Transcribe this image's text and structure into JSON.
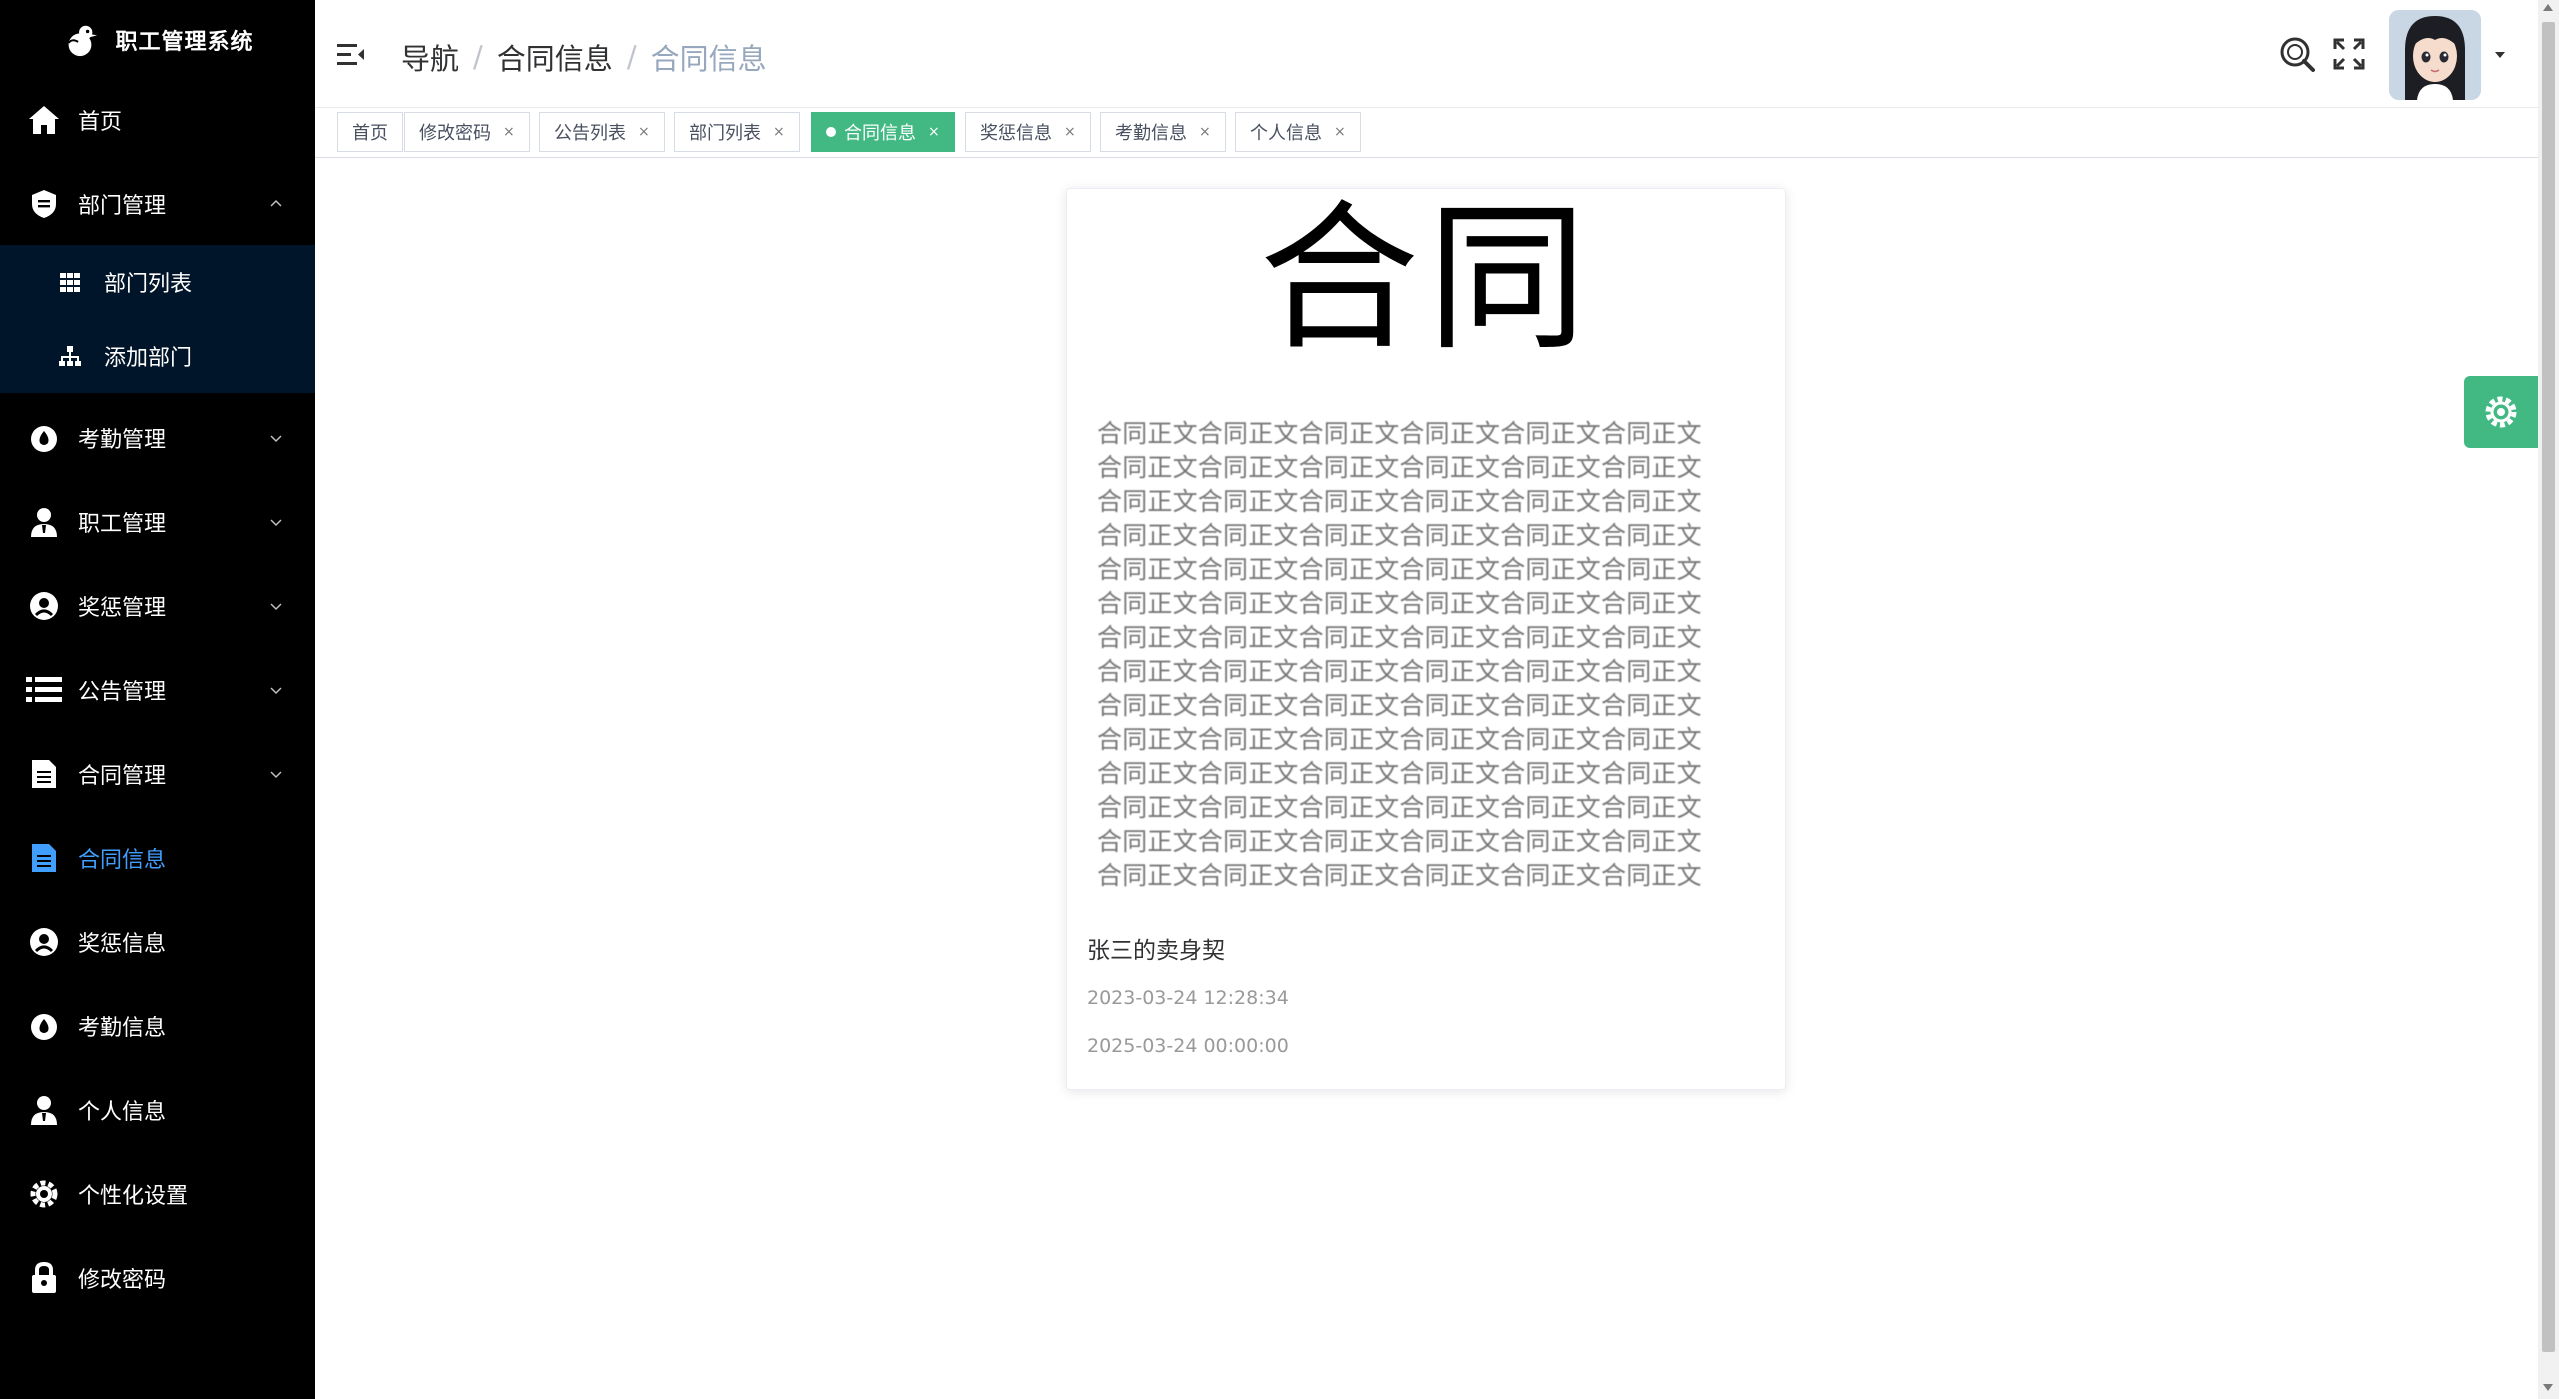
{
  "app": {
    "title": "职工管理系统",
    "logo_icon": "duck-logo-icon"
  },
  "sidebar": {
    "items": [
      {
        "label": "首页",
        "icon": "home-icon"
      },
      {
        "label": "部门管理",
        "icon": "department-icon",
        "expanded": true
      },
      {
        "label": "考勤管理",
        "icon": "drop-icon"
      },
      {
        "label": "职工管理",
        "icon": "user-icon"
      },
      {
        "label": "奖惩管理",
        "icon": "award-icon"
      },
      {
        "label": "公告管理",
        "icon": "list-icon"
      },
      {
        "label": "合同管理",
        "icon": "document-icon"
      },
      {
        "label": "合同信息",
        "icon": "contract-icon",
        "active": true
      },
      {
        "label": "奖惩信息",
        "icon": "award-icon"
      },
      {
        "label": "考勤信息",
        "icon": "drop-icon"
      },
      {
        "label": "个人信息",
        "icon": "user-icon"
      },
      {
        "label": "个性化设置",
        "icon": "gear-icon"
      },
      {
        "label": "修改密码",
        "icon": "lock-icon"
      }
    ],
    "submenu": [
      {
        "label": "部门列表",
        "icon": "grid-icon"
      },
      {
        "label": "添加部门",
        "icon": "tree-icon"
      }
    ],
    "active_color": "#409eff"
  },
  "header": {
    "breadcrumb": [
      "导航",
      "合同信息",
      "合同信息"
    ],
    "separator": "/"
  },
  "tags": [
    {
      "label": "首页",
      "closable": false
    },
    {
      "label": "修改密码",
      "closable": true
    },
    {
      "label": "公告列表",
      "closable": true
    },
    {
      "label": "部门列表",
      "closable": true
    },
    {
      "label": "合同信息",
      "closable": true,
      "active": true
    },
    {
      "label": "奖惩信息",
      "closable": true
    },
    {
      "label": "考勤信息",
      "closable": true
    },
    {
      "label": "个人信息",
      "closable": true
    }
  ],
  "tag_close_glyph": "×",
  "contract_card": {
    "image_heading": "合同",
    "image_body_text": "合同正文合同正文合同正文合同正文合同正文合同正文",
    "title": "张三的卖身契",
    "start_date": "2023-03-24 12:28:34",
    "end_date": "2025-03-24 00:00:00"
  },
  "colors": {
    "sidebar_bg": "#000000",
    "submenu_bg": "#001529",
    "accent": "#42b983",
    "active_link": "#409eff"
  }
}
